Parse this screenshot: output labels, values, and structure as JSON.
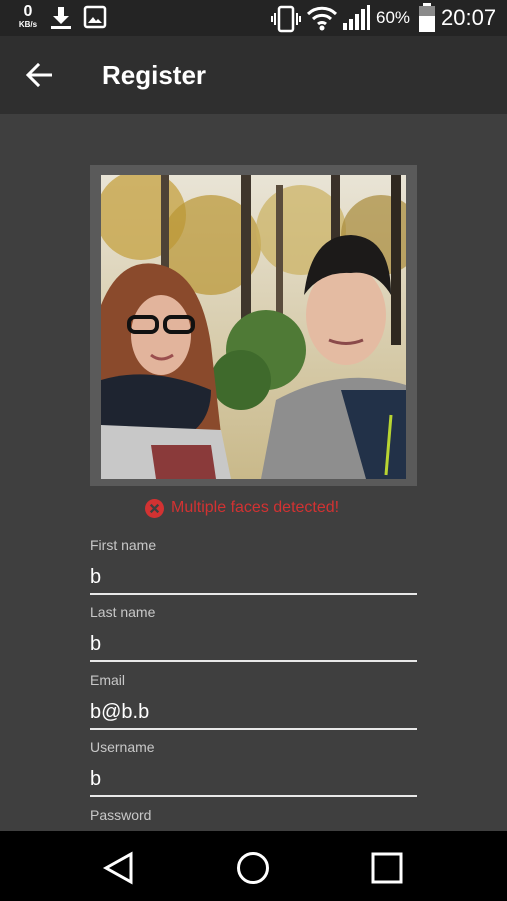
{
  "status_bar": {
    "net_speed_value": "0",
    "net_speed_unit": "KB/s",
    "battery_percent": "60%",
    "time": "20:07",
    "icons": [
      "download-icon",
      "image-icon",
      "vibrate-icon",
      "wifi-icon",
      "signal-icon",
      "battery-icon"
    ]
  },
  "app_bar": {
    "back_icon": "arrow-left-icon",
    "title": "Register"
  },
  "photo": {
    "icon": "photo-preview"
  },
  "error": {
    "icon": "error-circle-icon",
    "message": "Multiple faces detected!",
    "color": "#d23232"
  },
  "form": {
    "first_name": {
      "label": "First name",
      "value": "b"
    },
    "last_name": {
      "label": "Last name",
      "value": "b"
    },
    "email": {
      "label": "Email",
      "value": "b@b.b"
    },
    "username": {
      "label": "Username",
      "value": "b"
    },
    "password": {
      "label": "Password"
    }
  },
  "nav_bar": {
    "icons": [
      "back-triangle-icon",
      "home-circle-icon",
      "recents-square-icon"
    ]
  },
  "colors": {
    "background": "#3f3f3f",
    "app_bar": "#2f2f2f",
    "status_bar": "#242424",
    "nav_bar": "#000000"
  }
}
